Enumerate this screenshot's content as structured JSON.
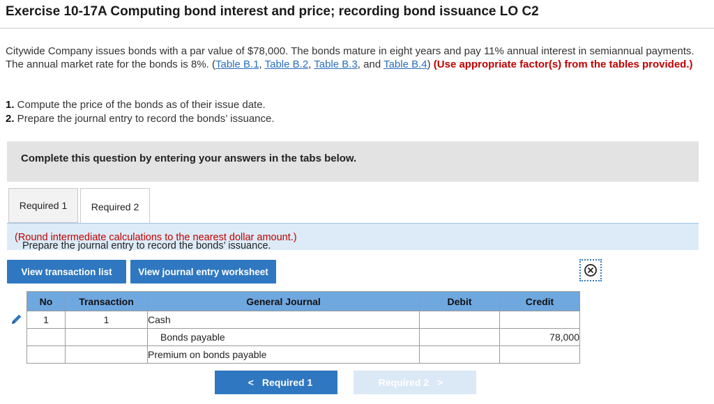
{
  "header": {
    "title": "Exercise 10-17A Computing bond interest and price; recording bond issuance LO C2"
  },
  "problem": {
    "text1": "Citywide Company issues bonds with a par value of $78,000. The bonds mature in eight years and pay 11% annual interest in semiannual payments. The annual market rate for the bonds is 8%. (",
    "links": [
      "Table B.1",
      "Table B.2",
      "Table B.3",
      "Table B.4"
    ],
    "sep1": ", ",
    "sep2": ", ",
    "sep3": ", and ",
    "close": ") ",
    "note": "(Use appropriate factor(s) from the tables provided.)"
  },
  "tasks": [
    {
      "num": "1.",
      "text": " Compute the price of the bonds as of their issue date."
    },
    {
      "num": "2.",
      "text": " Prepare the journal entry to record the bonds’ issuance."
    }
  ],
  "banner": "Complete this question by entering your answers in the tabs below.",
  "tabs": [
    "Required 1",
    "Required 2"
  ],
  "instruction": {
    "text": "Prepare the journal entry to record the bonds’ issuance.",
    "hint": "(Round intermediate calculations to the nearest dollar amount.)"
  },
  "buttons": {
    "view_transactions": "View transaction list",
    "view_worksheet": "View journal entry worksheet"
  },
  "journal": {
    "headers": [
      "No",
      "Transaction",
      "General Journal",
      "Debit",
      "Credit"
    ],
    "rows": [
      {
        "no": "1",
        "transaction": "1",
        "account": "Cash",
        "debit": "",
        "credit": ""
      },
      {
        "no": "",
        "transaction": "",
        "account": "Bonds payable",
        "debit": "",
        "credit": "78,000"
      },
      {
        "no": "",
        "transaction": "",
        "account": "Premium on bonds payable",
        "debit": "",
        "credit": ""
      }
    ]
  },
  "nav": {
    "prev": "Required 1",
    "next": "Required 2",
    "prev_arrow": "<",
    "next_arrow": ">"
  },
  "colors": {
    "accent": "#2f77c0",
    "header_blue": "#6fa7df",
    "instruction_bg": "#dcebf7",
    "warn_red": "#c00000"
  }
}
